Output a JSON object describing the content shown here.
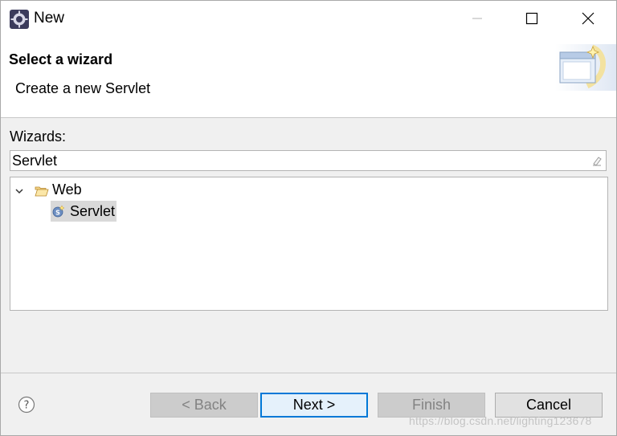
{
  "window": {
    "title": "New",
    "icon": "eclipse-gear-icon"
  },
  "header": {
    "title": "Select a wizard",
    "description": "Create a new Servlet",
    "image": "wizard-banner-icon"
  },
  "wizards": {
    "label": "Wizards:",
    "filter_value": "Servlet",
    "tree": [
      {
        "label": "Web",
        "icon": "folder-open-icon",
        "expanded": true
      },
      {
        "label": "Servlet",
        "icon": "servlet-icon",
        "selected": true
      }
    ]
  },
  "buttons": {
    "back": "< Back",
    "next": "Next >",
    "finish": "Finish",
    "cancel": "Cancel"
  },
  "watermark": "https://blog.csdn.net/lighting123678",
  "colors": {
    "accent": "#0078d7",
    "selection": "#d9d9d9"
  }
}
